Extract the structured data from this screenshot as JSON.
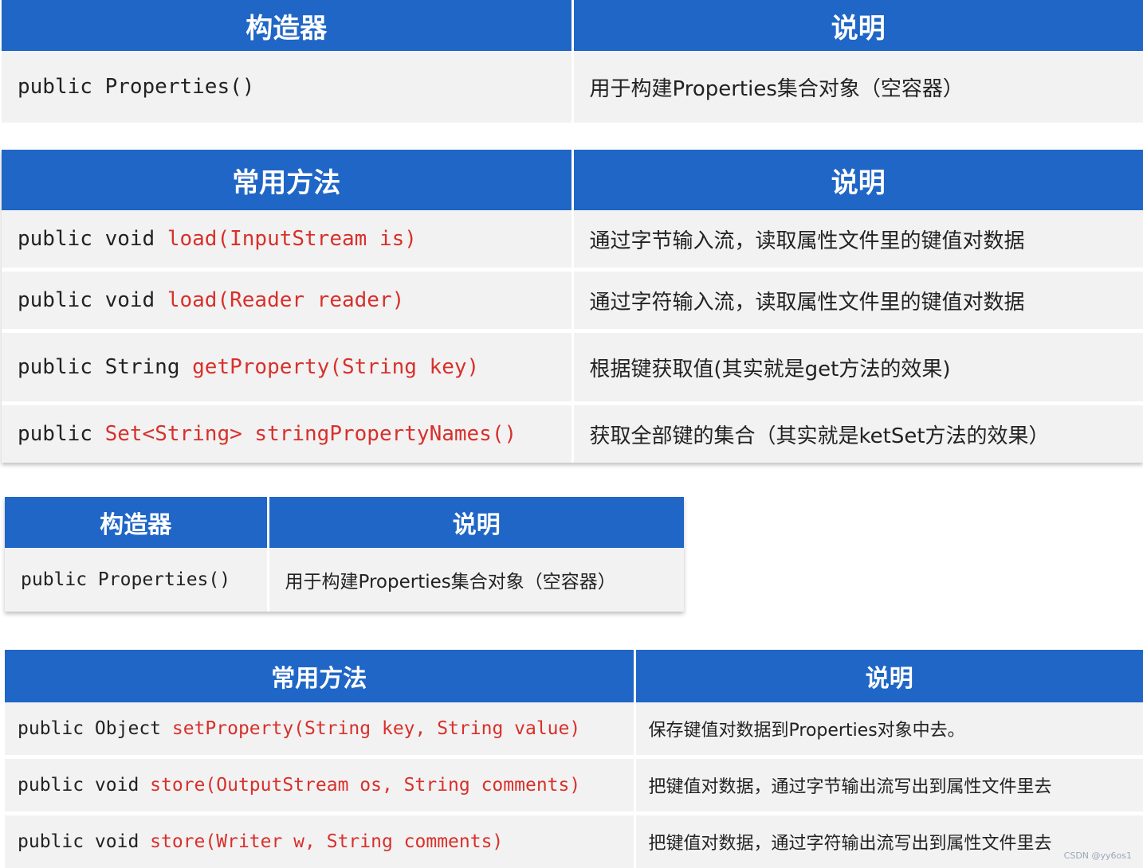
{
  "table1": {
    "headers": [
      "构造器",
      "说明"
    ],
    "rows": [
      {
        "code": "public Properties()",
        "desc": "用于构建Properties集合对象（空容器）"
      }
    ]
  },
  "table2": {
    "headers": [
      "常用方法",
      "说明"
    ],
    "rows": [
      {
        "prefix": "public void ",
        "sig": "load(InputStream is)",
        "desc": "通过字节输入流，读取属性文件里的键值对数据"
      },
      {
        "prefix": "public void ",
        "sig": "load(Reader reader)",
        "desc": "通过字符输入流，读取属性文件里的键值对数据"
      },
      {
        "prefix": "public String ",
        "sig": "getProperty(String key)",
        "desc": "根据键获取值(其实就是get方法的效果)"
      },
      {
        "prefix": "public ",
        "sig": "Set<String> stringPropertyNames()",
        "desc": "获取全部键的集合（其实就是ketSet方法的效果）"
      }
    ]
  },
  "table3": {
    "headers": [
      "构造器",
      "说明"
    ],
    "rows": [
      {
        "code": "public Properties()",
        "desc": "用于构建Properties集合对象（空容器）"
      }
    ]
  },
  "table4": {
    "headers": [
      "常用方法",
      "说明"
    ],
    "rows": [
      {
        "prefix": "public Object ",
        "sig": "setProperty(String key, String value)",
        "desc": "保存键值对数据到Properties对象中去。"
      },
      {
        "prefix": "public void ",
        "sig": "store(OutputStream os, String comments)",
        "desc": "把键值对数据，通过字节输出流写出到属性文件里去"
      },
      {
        "prefix": "public void ",
        "sig": "store(Writer w, String comments)",
        "desc": "把键值对数据，通过字符输出流写出到属性文件里去"
      }
    ]
  },
  "watermark": "CSDN @yy6os1",
  "colors": {
    "header_bg": "#1f66c7",
    "row_bg": "#f2f2f2",
    "highlight": "#d8302b"
  }
}
